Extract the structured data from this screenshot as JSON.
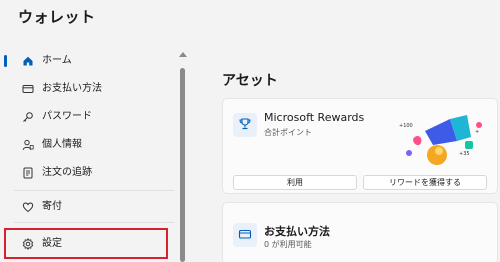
{
  "app": {
    "title": "ウォレット"
  },
  "sidebar": {
    "items": [
      {
        "label": "ホーム",
        "icon": "home-icon",
        "active": true
      },
      {
        "label": "お支払い方法",
        "icon": "credit-card-icon"
      },
      {
        "label": "パスワード",
        "icon": "key-icon"
      },
      {
        "label": "個人情報",
        "icon": "person-icon"
      },
      {
        "label": "注文の追跡",
        "icon": "receipt-icon"
      },
      {
        "label": "寄付",
        "icon": "heart-icon"
      },
      {
        "label": "設定",
        "icon": "gear-icon"
      }
    ]
  },
  "main": {
    "section_title": "アセット",
    "rewards_card": {
      "title": "Microsoft Rewards",
      "subtitle": "合計ポイント",
      "use_button": "利用",
      "earn_button": "リワードを獲得する"
    },
    "payment_card": {
      "title": "お支払い方法",
      "subtitle": "0 が利用可能"
    }
  },
  "colors": {
    "accent": "#005fb8",
    "highlight_box": "#d6212e"
  }
}
